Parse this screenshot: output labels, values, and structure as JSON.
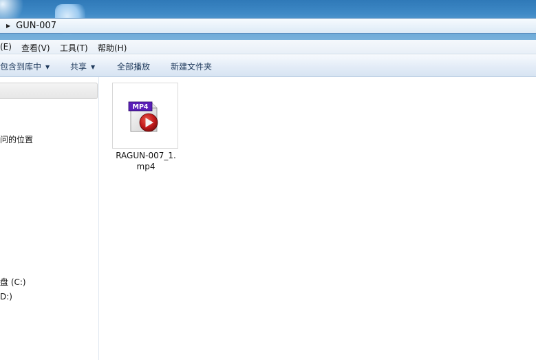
{
  "address": {
    "path": "GUN-007"
  },
  "menu": [
    {
      "label": "(E)"
    },
    {
      "label": "查看(V)"
    },
    {
      "label": "工具(T)"
    },
    {
      "label": "帮助(H)"
    }
  ],
  "toolbar": {
    "include_library": "包含到库中",
    "share": "共享",
    "play_all": "全部播放",
    "new_folder": "新建文件夹"
  },
  "nav": {
    "recent_places": "问的位置",
    "local_disk_c": "盘 (C:)",
    "disk_d": "D:)"
  },
  "files": [
    {
      "name": "RAGUN-007_1.\nmp4",
      "icon": "mp4-video-icon",
      "badge": "MP4"
    }
  ],
  "colors": {
    "accent": "#1e395b",
    "mp4_badge": "#5a1fb8",
    "play_red": "#c2191a"
  }
}
